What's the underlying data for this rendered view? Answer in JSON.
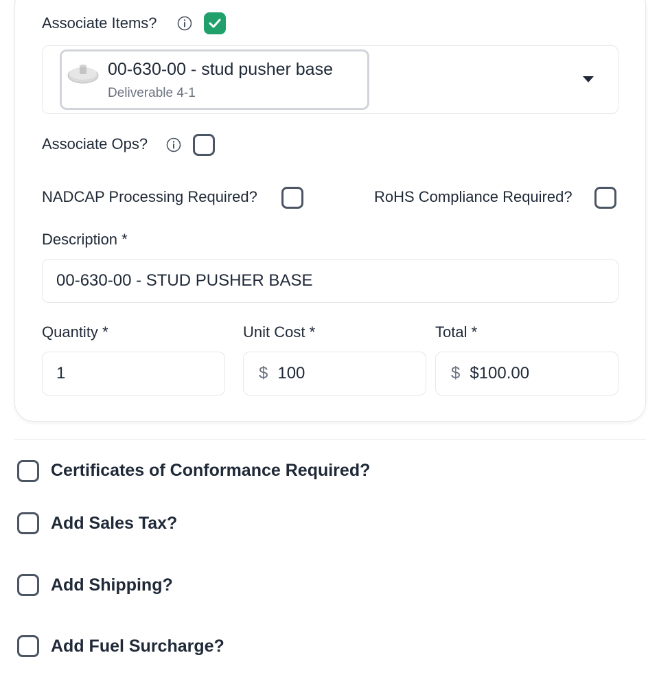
{
  "associate_items": {
    "label": "Associate Items?",
    "checked": true
  },
  "item_select": {
    "item_title": "00-630-00 - stud pusher base",
    "item_subtitle": "Deliverable 4-1"
  },
  "associate_ops": {
    "label": "Associate Ops?",
    "checked": false
  },
  "nadcap": {
    "label": "NADCAP Processing Required?",
    "checked": false
  },
  "rohs": {
    "label": "RoHS Compliance Required?",
    "checked": false
  },
  "description": {
    "label": "Description",
    "required": "*",
    "value": "00-630-00 - STUD PUSHER BASE"
  },
  "quantity": {
    "label": "Quantity",
    "required": "*",
    "value": "1"
  },
  "unit_cost": {
    "label": "Unit Cost",
    "required": "*",
    "currency": "$",
    "value": "100"
  },
  "total": {
    "label": "Total",
    "required": "*",
    "currency": "$",
    "value": "$100.00"
  },
  "options": [
    {
      "label": "Certificates of Conformance Required?",
      "checked": false
    },
    {
      "label": "Add Sales Tax?",
      "checked": false
    },
    {
      "label": "Add Shipping?",
      "checked": false
    },
    {
      "label": "Add Fuel Surcharge?",
      "checked": false
    }
  ],
  "colors": {
    "accent": "#22a06b",
    "text": "#1f2937",
    "muted": "#6b7280",
    "border": "#e5e7eb"
  },
  "icons": {
    "info": "info-icon",
    "check": "check-icon",
    "dropdown": "caret-down-icon",
    "item_thumbnail": "part-thumbnail-icon"
  }
}
